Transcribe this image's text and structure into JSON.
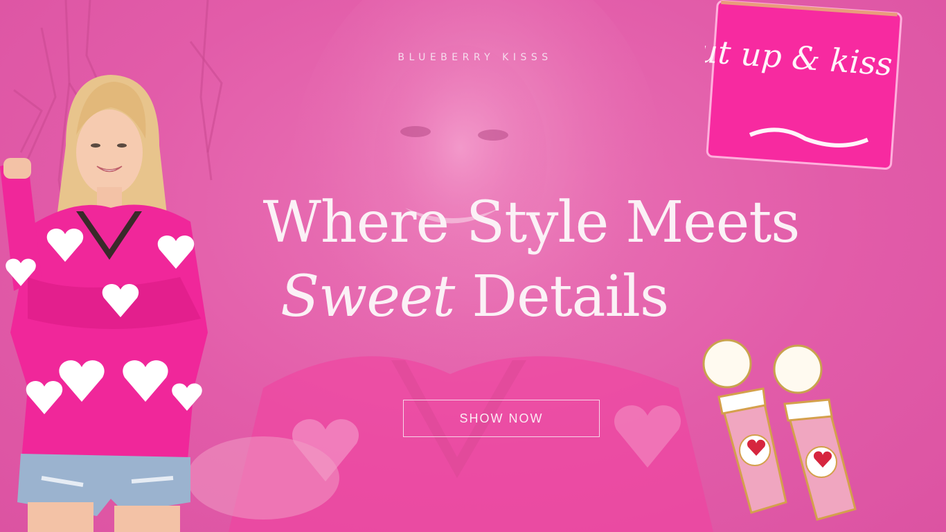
{
  "brand": {
    "name": "BLUEBERRY KISSS"
  },
  "headline": {
    "line1": "Where Style Meets",
    "line2_italic": "Sweet",
    "line2_rest": " Details"
  },
  "cta": {
    "label": "SHOW NOW"
  },
  "colors": {
    "background": "#e35eaa",
    "text": "#fbf1f6",
    "sweater": "#f0279a",
    "hearts": "#ffffff"
  },
  "pouch": {
    "text": "shut up & kiss me"
  }
}
